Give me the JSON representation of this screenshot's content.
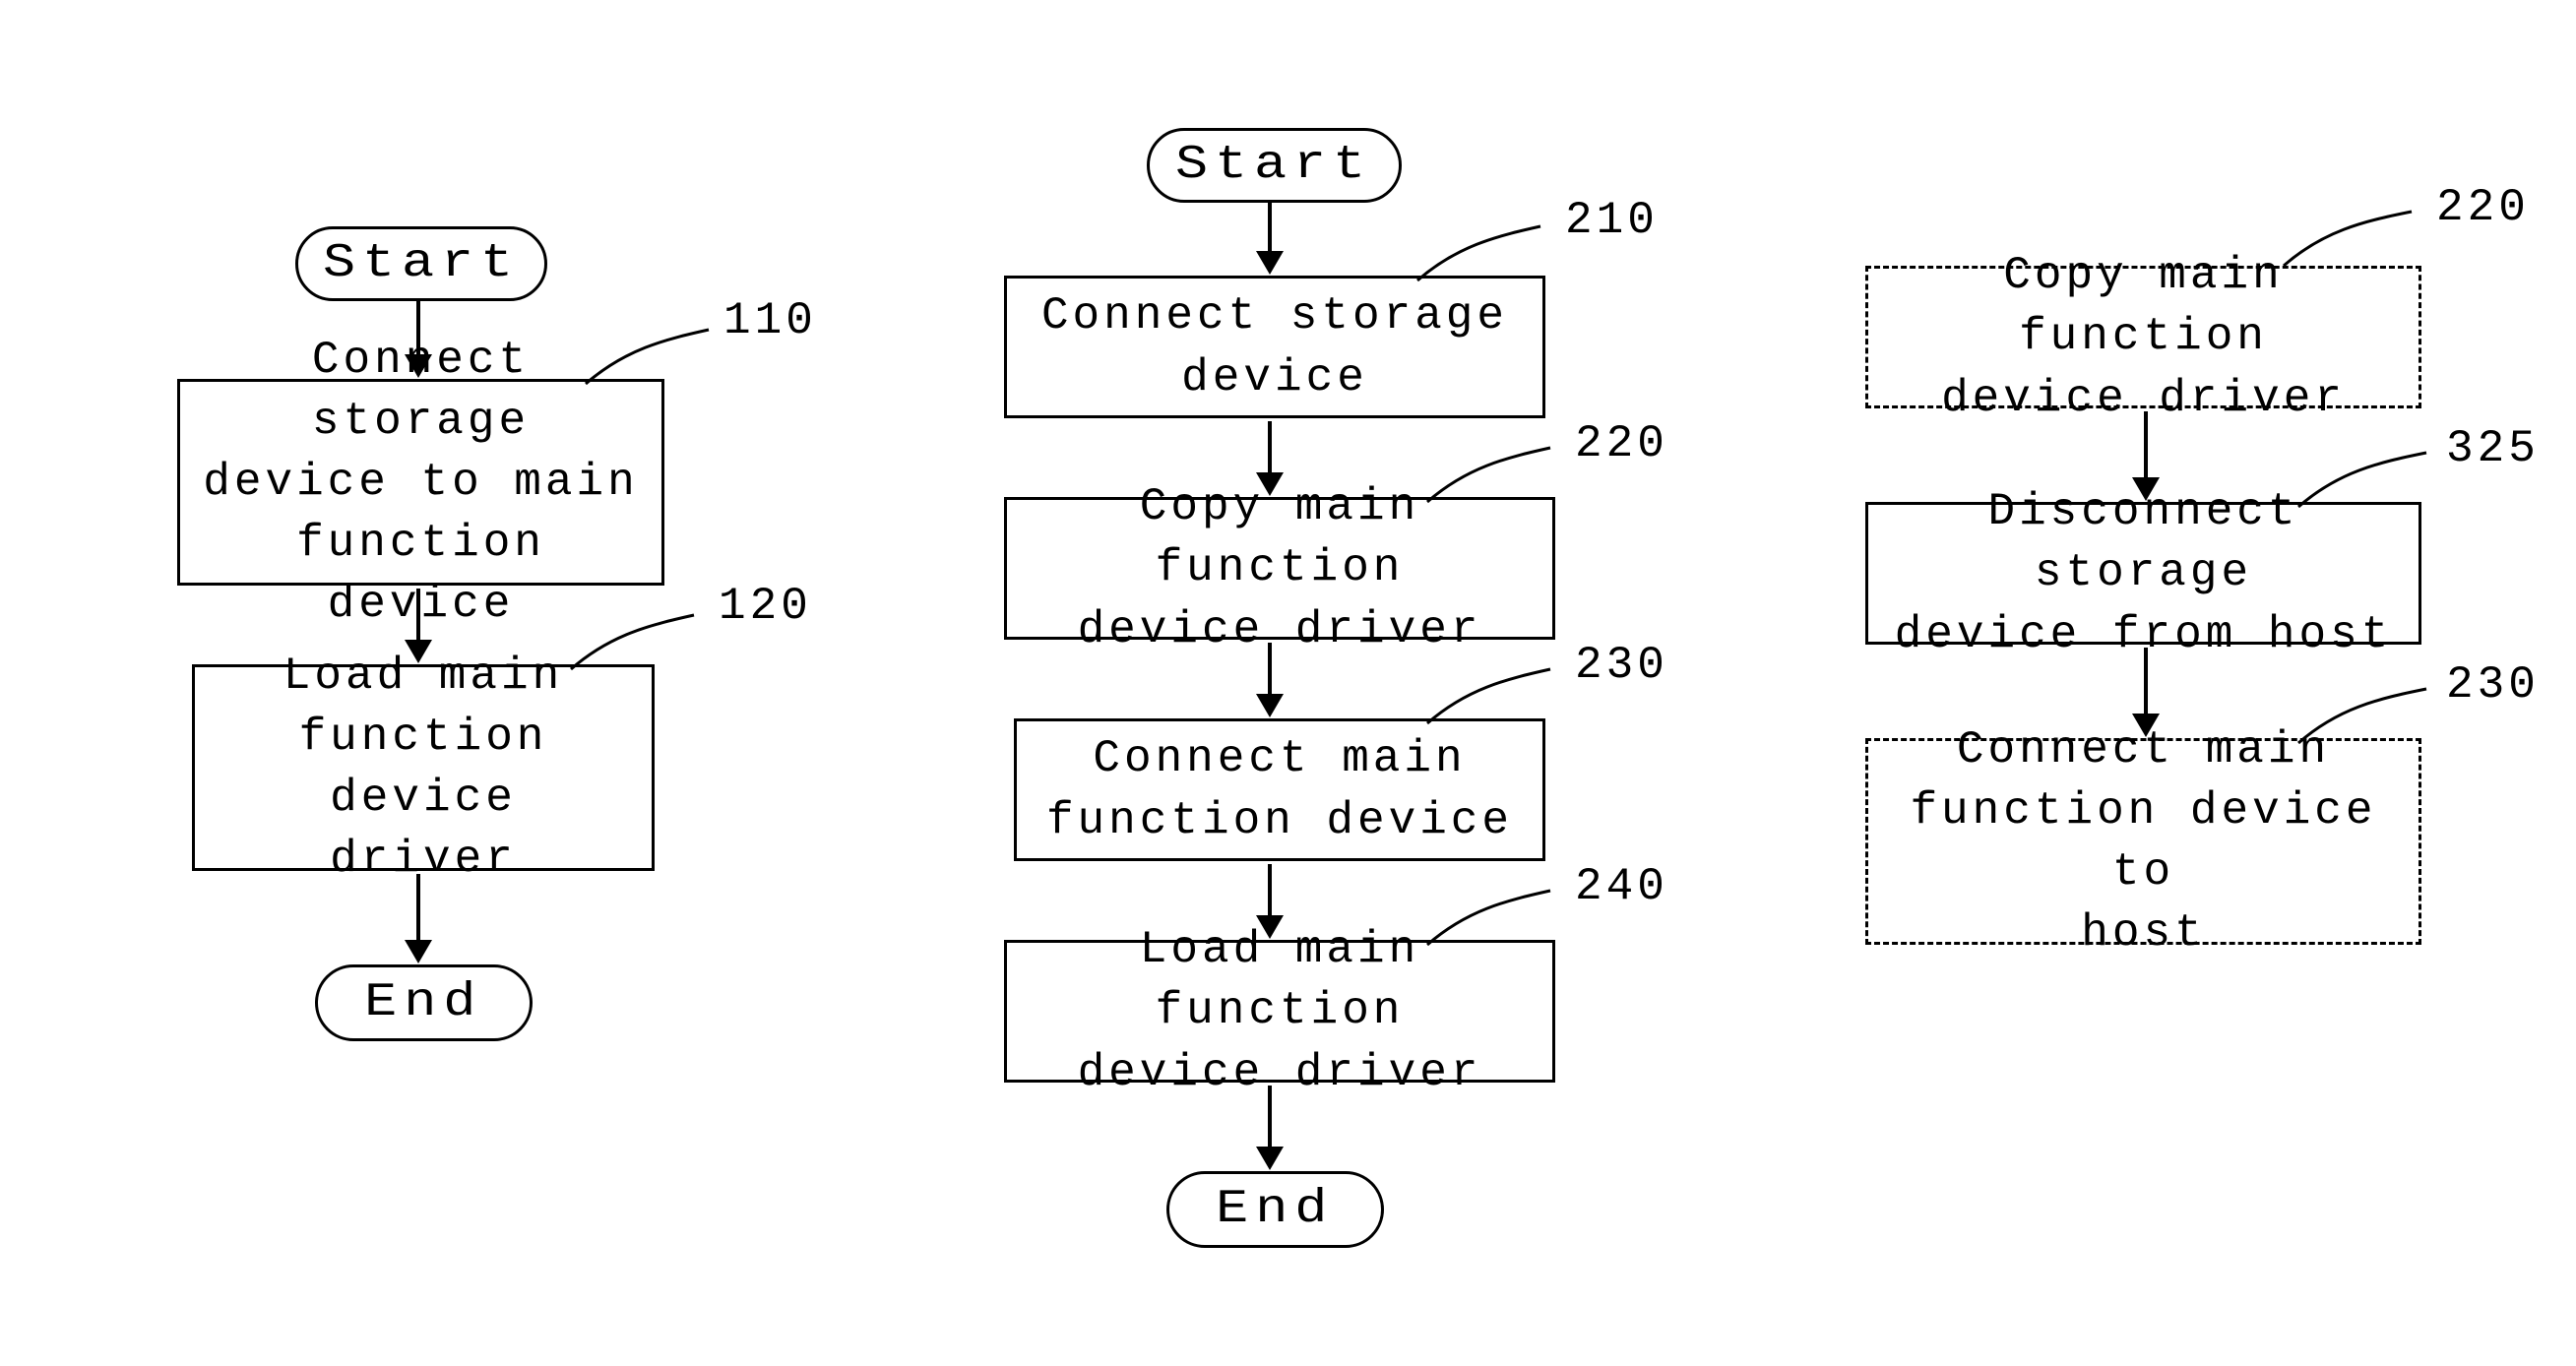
{
  "flowcharts": {
    "left": {
      "start": "Start",
      "end": "End",
      "steps": [
        {
          "ref": "110",
          "text_lines": [
            "Connect storage",
            "device to main",
            "function device"
          ]
        },
        {
          "ref": "120",
          "text_lines": [
            "Load main",
            "function device",
            "driver"
          ]
        }
      ]
    },
    "center": {
      "start": "Start",
      "end": "End",
      "steps": [
        {
          "ref": "210",
          "text_lines": [
            "Connect storage",
            "device"
          ]
        },
        {
          "ref": "220",
          "text_lines": [
            "Copy main function",
            "device driver"
          ]
        },
        {
          "ref": "230",
          "text_lines": [
            "Connect main",
            "function device"
          ]
        },
        {
          "ref": "240",
          "text_lines": [
            "Load main function",
            "device driver"
          ]
        }
      ]
    },
    "right": {
      "steps": [
        {
          "ref": "220",
          "text_lines": [
            "Copy main function",
            "device driver"
          ]
        },
        {
          "ref": "325",
          "text_lines": [
            "Disconnect storage",
            "device from host"
          ]
        },
        {
          "ref": "230",
          "text_lines": [
            "Connect main",
            "function device to",
            "host"
          ]
        }
      ]
    }
  }
}
